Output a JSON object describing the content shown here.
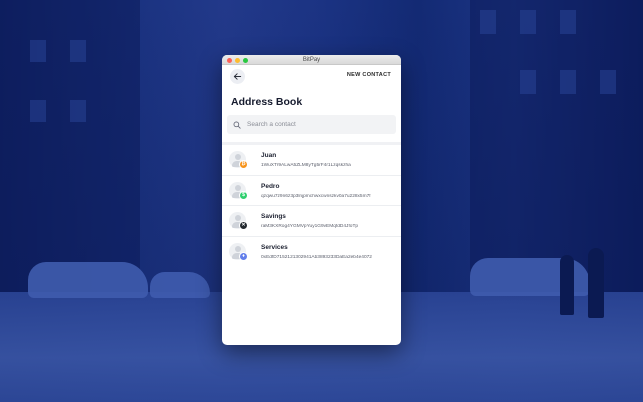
{
  "window": {
    "title": "BitPay"
  },
  "header": {
    "new_contact_label": "NEW CONTACT",
    "page_title": "Address Book"
  },
  "search": {
    "placeholder": "Search a contact"
  },
  "contacts": [
    {
      "name": "Juan",
      "address": "1WuXTr9ALwA5ZLM8yTg5rF4r1Lzqskzha",
      "coin": "btc",
      "coin_color": "#f7931a",
      "coin_symbol": "₿"
    },
    {
      "name": "Pedro",
      "address": "qzqwu7z9n6z3p3lnjpmchwxcwnszkv0a7u228x5m7f",
      "coin": "bch",
      "coin_color": "#2fcf6e",
      "coin_symbol": "$"
    },
    {
      "name": "Savings",
      "address": "raM3KXRog4YGMVpYuy1G9vEMqfdD4JfoTp",
      "coin": "xrp",
      "coin_color": "#23292f",
      "coin_symbol": "✕"
    },
    {
      "name": "Services",
      "address": "0xEdfD7152121302941Ab3893233DaEa2eb4e4072",
      "coin": "eth",
      "coin_color": "#627eea",
      "coin_symbol": "♦"
    }
  ]
}
